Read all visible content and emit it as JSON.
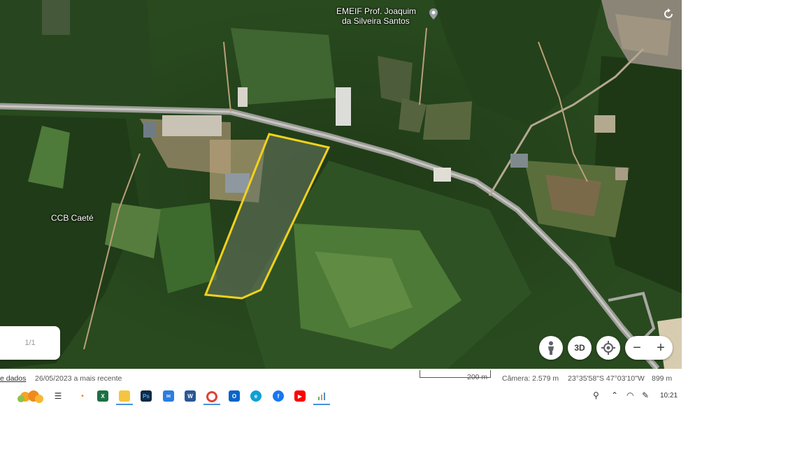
{
  "map": {
    "labels": {
      "school_line1": "EMEIF Prof. Joaquim",
      "school_line2": "da Silveira Santos",
      "church": "CCB  Caeté"
    },
    "boundary_color": "#f2d21b"
  },
  "controls": {
    "pegman_icon": "person-icon",
    "mode_3d": "3D",
    "locate_icon": "target-icon",
    "zoom_out": "−",
    "zoom_in": "+",
    "rotate_icon": "rotate-icon"
  },
  "pager": {
    "label": "1/1"
  },
  "status": {
    "data_link": "e dados",
    "imagery_date": "26/05/2023 a mais recente",
    "scale": "200 m",
    "camera": "Câmera: 2.579 m",
    "coords": "23°35'58\"S 47°03'10\"W",
    "elevation": "899 m"
  },
  "taskbar": {
    "apps": [
      "windows-logo",
      "task-view-icon",
      "widgets-icon",
      "excel-icon",
      "file-explorer-icon",
      "photoshop-icon",
      "mail-icon",
      "word-icon",
      "chrome-icon",
      "outlook-icon",
      "edge-icon",
      "facebook-icon",
      "youtube-icon",
      "charts-app-icon"
    ],
    "clock": "10:21"
  }
}
